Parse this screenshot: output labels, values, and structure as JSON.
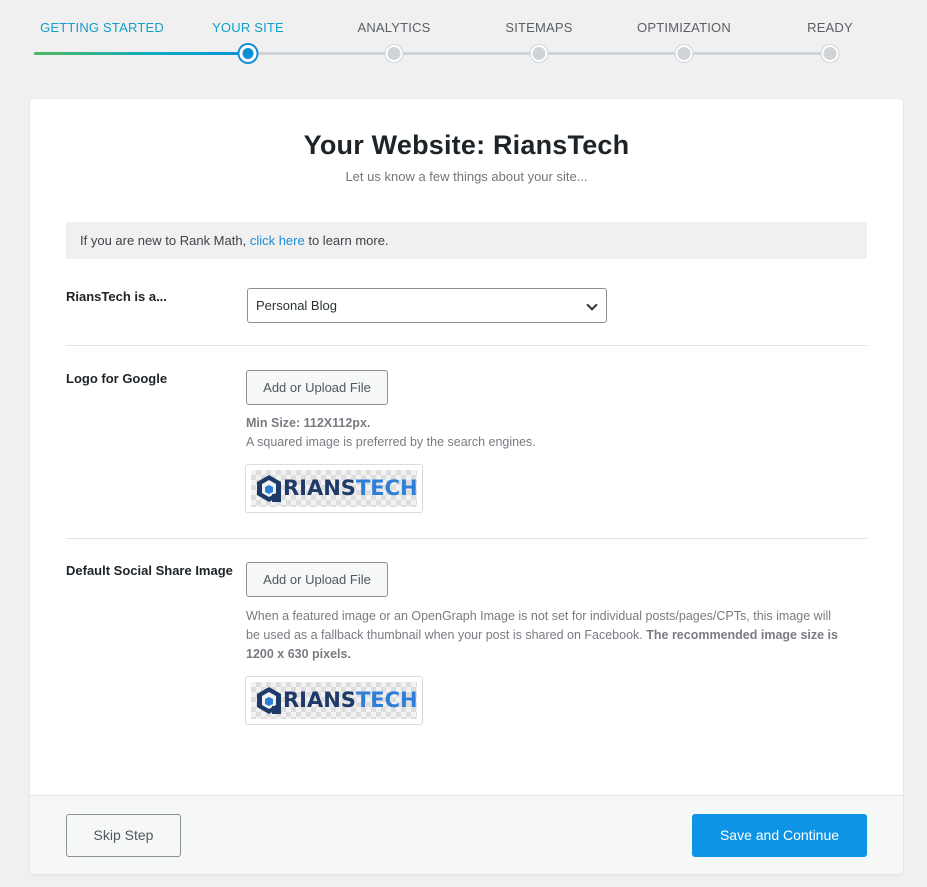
{
  "steps": [
    {
      "label": "GETTING STARTED",
      "state": "done"
    },
    {
      "label": "YOUR SITE",
      "state": "active"
    },
    {
      "label": "ANALYTICS",
      "state": "pending"
    },
    {
      "label": "SITEMAPS",
      "state": "pending"
    },
    {
      "label": "OPTIMIZATION",
      "state": "pending"
    },
    {
      "label": "READY",
      "state": "pending"
    }
  ],
  "page": {
    "title": "Your Website: RiansTech",
    "subtitle": "Let us know a few things about your site..."
  },
  "notice": {
    "prefix": "If you are new to Rank Math, ",
    "link": "click here",
    "suffix": " to learn more."
  },
  "site_type": {
    "label": "RiansTech is a...",
    "selected": "Personal Blog"
  },
  "logo": {
    "label": "Logo for Google",
    "button": "Add or Upload File",
    "min_size": "Min Size: 112X112px.",
    "help": "A squared image is preferred by the search engines.",
    "image_text_a": "RIANS",
    "image_text_b": "TECH"
  },
  "social": {
    "label": "Default Social Share Image",
    "button": "Add or Upload File",
    "help_line1": "When a featured image or an OpenGraph Image is not set for individual posts/pages/CPTs, this image will",
    "help_line2": "be used as a fallback thumbnail when your post is shared on Facebook. ",
    "help_bold2": "The recommended image size is",
    "help_bold3": "1200 x 630 pixels.",
    "image_text_a": "RIANS",
    "image_text_b": "TECH"
  },
  "footer": {
    "skip": "Skip Step",
    "save": "Save and Continue"
  },
  "colors": {
    "accent": "#0d94e4",
    "step_active": "#10a0c8",
    "done_green": "#4fb85f",
    "background": "#f0f0f1"
  }
}
